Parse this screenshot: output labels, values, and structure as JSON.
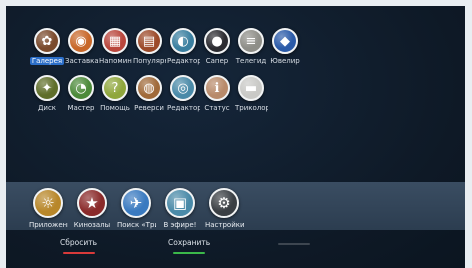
{
  "apps_row1": [
    {
      "label": "Галерея",
      "icon": "gallery-icon",
      "glyph": "✿",
      "bg": "#7a4a2c",
      "selected": true
    },
    {
      "label": "Заставка",
      "icon": "screensaver-icon",
      "glyph": "◉",
      "bg": "#c8682a"
    },
    {
      "label": "Напоминания",
      "icon": "reminder-icon",
      "glyph": "▦",
      "bg": "#b9463c"
    },
    {
      "label": "Популярное",
      "icon": "popular-icon",
      "glyph": "▤",
      "bg": "#9c4a2a"
    },
    {
      "label": "Редактор",
      "icon": "editor-icon",
      "glyph": "◐",
      "bg": "#3a7fa0"
    },
    {
      "label": "Сапер",
      "icon": "minesweeper-icon",
      "glyph": "●",
      "bg": "#2b2b30"
    },
    {
      "label": "Телегид",
      "icon": "tv-guide-icon",
      "glyph": "≡",
      "bg": "#8e8e88"
    },
    {
      "label": "Ювелир",
      "icon": "jeweler-icon",
      "glyph": "◆",
      "bg": "#2a5aa8"
    }
  ],
  "apps_row2": [
    {
      "label": "Диск",
      "icon": "disk-icon",
      "glyph": "✦",
      "bg": "#5f6e2a"
    },
    {
      "label": "Мастер",
      "icon": "wizard-icon",
      "glyph": "◔",
      "bg": "#4c8a3a"
    },
    {
      "label": "Помощь",
      "icon": "help-icon",
      "glyph": "?",
      "bg": "#8fa63c"
    },
    {
      "label": "Реверси",
      "icon": "reversi-icon",
      "glyph": "◍",
      "bg": "#a06a3a"
    },
    {
      "label": "Редактор",
      "icon": "editor-2-icon",
      "glyph": "◎",
      "bg": "#4a8aa8"
    },
    {
      "label": "Статус",
      "icon": "status-icon",
      "glyph": "ℹ",
      "bg": "#b88a6a"
    },
    {
      "label": "Триколор",
      "icon": "tricolor-icon",
      "glyph": "▬",
      "bg": "#c9c9c6"
    }
  ],
  "dock": [
    {
      "label": "Приложения",
      "icon": "apps-icon",
      "glyph": "☼",
      "bg": "#b8872a"
    },
    {
      "label": "Кинозалы",
      "icon": "cinema-icon",
      "glyph": "★",
      "bg": "#8a2a2a"
    },
    {
      "label": "Поиск «Триколор»",
      "icon": "search-icon",
      "glyph": "✈",
      "bg": "#3a7ac0"
    },
    {
      "label": "В эфире!",
      "icon": "on-air-icon",
      "glyph": "▣",
      "bg": "#4a8aa8"
    },
    {
      "label": "Настройки",
      "icon": "settings-gear-icon",
      "glyph": "⚙",
      "bg": "#3a3f44"
    }
  ],
  "actions": [
    {
      "label": "Сбросить",
      "name": "reset-button",
      "color": "#d83a3a"
    },
    {
      "label": "Сохранить",
      "name": "save-button",
      "color": "#3bb84a"
    },
    {
      "label": "",
      "name": "third-action",
      "color": "#3d4650"
    }
  ],
  "colors": {
    "selection": "#2c6fc9",
    "background": "#0f1a26"
  }
}
